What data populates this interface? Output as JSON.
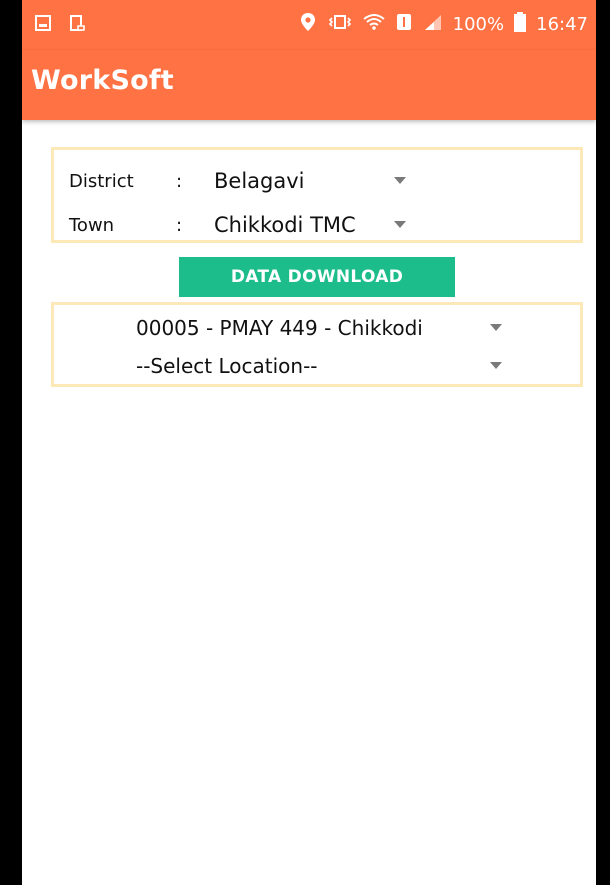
{
  "status_bar": {
    "battery": "100%",
    "time": "16:47",
    "icons": [
      "gallery-icon",
      "screen-capture-icon",
      "location-icon",
      "vibrate-icon",
      "wifi-icon",
      "sim-icon",
      "signal-icon",
      "battery-icon"
    ]
  },
  "app_bar": {
    "title": "WorkSoft",
    "color": "#fe7243"
  },
  "filters": {
    "district": {
      "label": "District",
      "separator": ":",
      "value": "Belagavi"
    },
    "town": {
      "label": "Town",
      "separator": ":",
      "value": "Chikkodi TMC"
    }
  },
  "download_button": {
    "label": "DATA DOWNLOAD",
    "color": "#1dbd8b"
  },
  "selection": {
    "project": {
      "value": "00005 - PMAY 449 - Chikkodi"
    },
    "location": {
      "value": "--Select Location--"
    }
  }
}
